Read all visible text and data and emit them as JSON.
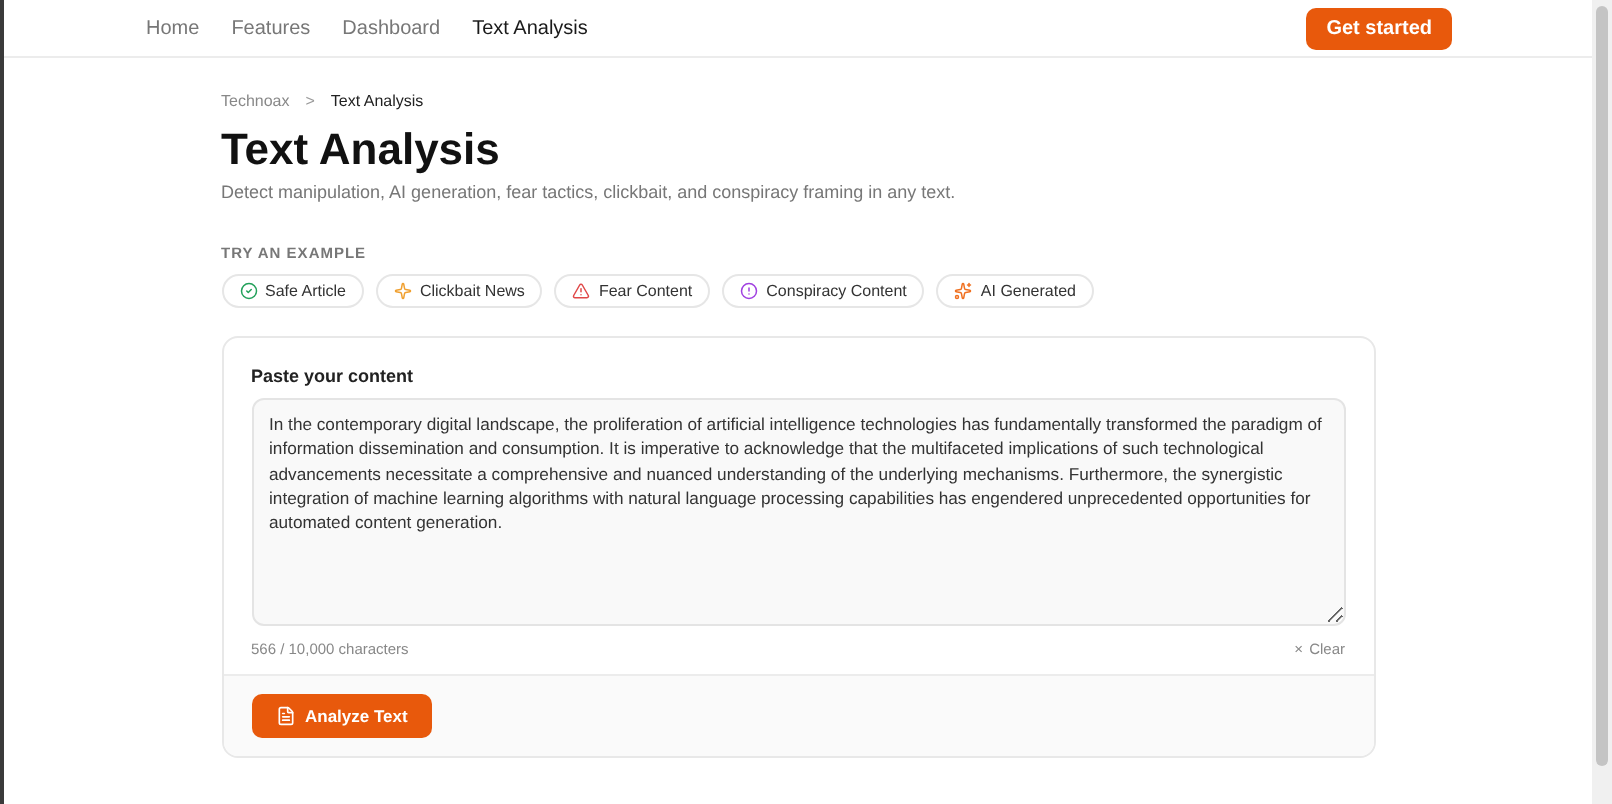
{
  "nav": {
    "links": [
      {
        "label": "Home",
        "selected": false
      },
      {
        "label": "Features",
        "selected": false
      },
      {
        "label": "Dashboard",
        "selected": false
      },
      {
        "label": "Text Analysis",
        "selected": true
      }
    ],
    "cta": "Get started"
  },
  "breadcrumb": {
    "items": [
      "Technoax",
      "Text Analysis"
    ],
    "separator": ">"
  },
  "title": "Text Analysis",
  "subtitle": "Detect manipulation, AI generation, fear tactics, clickbait, and conspiracy framing in any text.",
  "examples": {
    "heading": "TRY AN EXAMPLE",
    "chips": [
      {
        "label": "Safe Article",
        "kind": "safe",
        "color": "#22a05a"
      },
      {
        "label": "Clickbait News",
        "kind": "clickbait",
        "color": "#f0a030"
      },
      {
        "label": "Fear Content",
        "kind": "fear",
        "color": "#e04848"
      },
      {
        "label": "Conspiracy Content",
        "kind": "conspiracy",
        "color": "#a040e0"
      },
      {
        "label": "AI Generated",
        "kind": "ai",
        "color": "#f07020"
      }
    ]
  },
  "editor": {
    "label": "Paste your content",
    "value": "In the contemporary digital landscape, the proliferation of artificial intelligence technologies has fundamentally transformed the paradigm of information dissemination and consumption. It is imperative to acknowledge that the multifaceted implications of such technological advancements necessitate a comprehensive and nuanced understanding of the underlying mechanisms. Furthermore, the synergistic integration of machine learning algorithms with natural language processing capabilities has engendered unprecedented opportunities for automated content generation.",
    "counter": "566 / 10,000 characters",
    "clear": "Clear",
    "clear_icon": "×",
    "submit": "Analyze Text"
  }
}
